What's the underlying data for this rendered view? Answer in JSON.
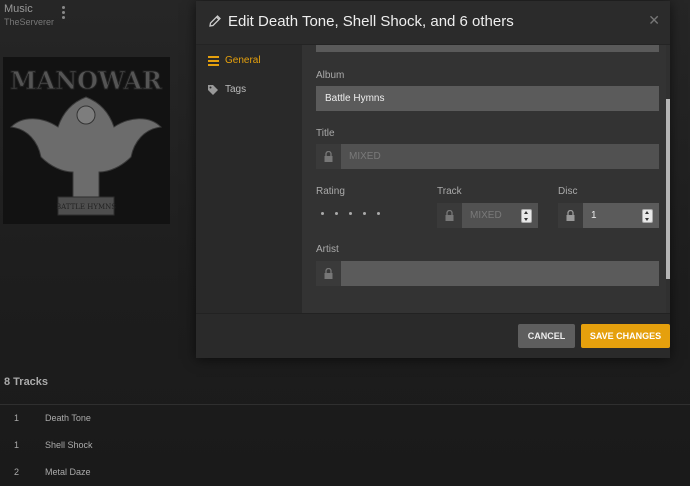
{
  "app": {
    "section_title": "Music",
    "server_name": "TheServerer"
  },
  "album_art": {
    "band_text": "MANOWAR",
    "album_text": "BATTLE HYMNS"
  },
  "tracklist": {
    "heading": "8 Tracks",
    "rows": [
      {
        "num": "1",
        "name": "Death Tone"
      },
      {
        "num": "1",
        "name": "Shell Shock"
      },
      {
        "num": "2",
        "name": "Metal Daze"
      }
    ]
  },
  "modal": {
    "title": "Edit Death Tone, Shell Shock, and 6 others",
    "nav": [
      {
        "label": "General",
        "active": true
      },
      {
        "label": "Tags",
        "active": false
      }
    ],
    "fields": {
      "album_label": "Album",
      "album_value": "Battle Hymns",
      "title_label": "Title",
      "title_placeholder": "MIXED",
      "rating_label": "Rating",
      "track_label": "Track",
      "track_placeholder": "MIXED",
      "disc_label": "Disc",
      "disc_value": "1",
      "artist_label": "Artist",
      "artist_value": ""
    },
    "buttons": {
      "cancel": "CANCEL",
      "save": "SAVE CHANGES"
    }
  },
  "colors": {
    "accent": "#e5a00d",
    "modal_bg": "#303030",
    "input_bg": "#5b5b5b"
  }
}
